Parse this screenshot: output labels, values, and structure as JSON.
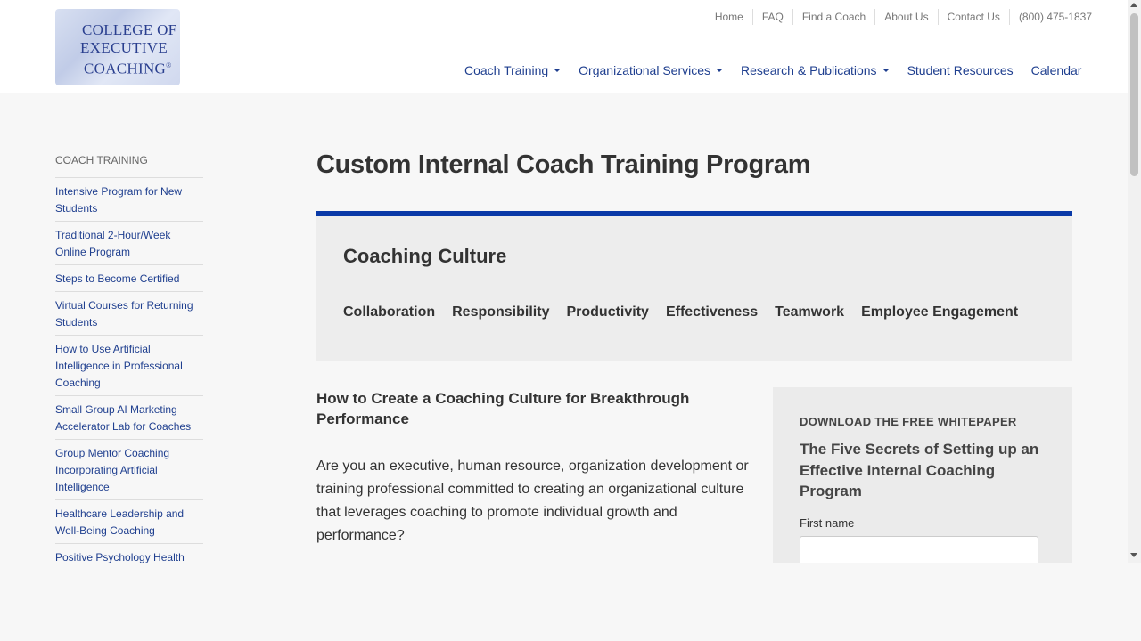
{
  "logo": {
    "line1": "COLLEGE OF",
    "line2": "EXECUTIVE",
    "line3": "COACHING",
    "mark": "®"
  },
  "utility_nav": [
    "Home",
    "FAQ",
    "Find a Coach",
    "About Us",
    "Contact Us",
    "(800) 475-1837"
  ],
  "main_nav": [
    {
      "label": "Coach Training",
      "dropdown": true
    },
    {
      "label": "Organizational Services",
      "dropdown": true
    },
    {
      "label": "Research & Publications",
      "dropdown": true
    },
    {
      "label": "Student Resources",
      "dropdown": false
    },
    {
      "label": "Calendar",
      "dropdown": false
    }
  ],
  "sidebar": {
    "title": "COACH TRAINING",
    "items": [
      "Intensive Program for New Students",
      "Traditional 2-Hour/Week Online Program",
      "Steps to Become Certified",
      "Virtual Courses for Returning Students",
      "How to Use Artificial Intelligence in Professional Coaching",
      "Small Group AI Marketing Accelerator Lab for Coaches",
      "Group Mentor Coaching Incorporating Artificial Intelligence",
      "Healthcare Leadership and Well-Being Coaching",
      "Positive Psychology Health"
    ]
  },
  "page": {
    "title": "Custom Internal Coach Training Program"
  },
  "culture": {
    "title": "Coaching Culture",
    "tags": [
      "Collaboration",
      "Responsibility",
      "Productivity",
      "Effectiveness",
      "Teamwork",
      "Employee Engagement"
    ]
  },
  "article": {
    "title": "How to Create a Coaching Culture for Breakthrough Performance",
    "body": "Are you an executive, human resource, organization development or training professional committed to creating an organizational culture that leverages coaching to promote individual growth and performance?"
  },
  "whitepaper": {
    "label": "DOWNLOAD THE FREE WHITEPAPER",
    "title": "The Five Secrets of Setting up an Effective Internal Coaching Program",
    "first_name_label": "First name",
    "first_name_value": ""
  },
  "colors": {
    "brand_blue": "#1f3f8f",
    "accent_bar": "#0a3aa8"
  }
}
